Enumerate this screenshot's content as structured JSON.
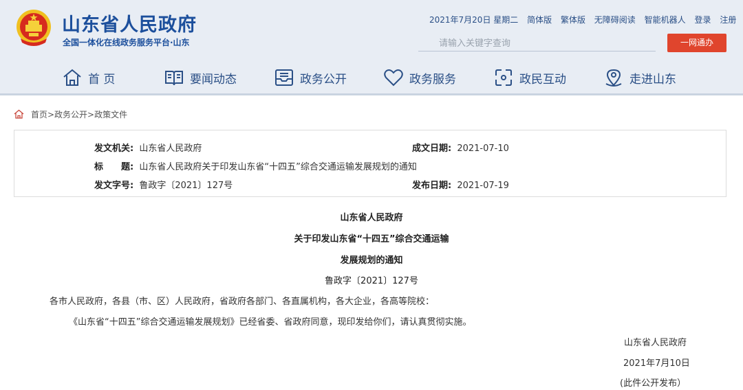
{
  "header": {
    "site_title": "山东省人民政府",
    "site_subtitle": "全国一体化在线政务服务平台·山东",
    "top_links": {
      "date": "2021年7月20日 星期二",
      "simplified": "简体版",
      "traditional": "繁体版",
      "accessible": "无障碍阅读",
      "robot": "智能机器人",
      "login": "登录",
      "register": "注册"
    },
    "search_placeholder": "请输入关键字查询",
    "onenet_button": "一网通办",
    "brand_color": "#1c4f9c",
    "accent_color": "#e0452d"
  },
  "nav": [
    {
      "label": "首 页",
      "icon": "home-icon"
    },
    {
      "label": "要闻动态",
      "icon": "book-icon"
    },
    {
      "label": "政务公开",
      "icon": "inbox-icon"
    },
    {
      "label": "政务服务",
      "icon": "heart-icon"
    },
    {
      "label": "政民互动",
      "icon": "interaction-icon"
    },
    {
      "label": "走进山东",
      "icon": "location-icon"
    }
  ],
  "breadcrumb": "首页>政务公开>政策文件",
  "meta": {
    "issuer_label": "发文机关:",
    "issuer": "山东省人民政府",
    "date_made_label": "成文日期:",
    "date_made": "2021-07-10",
    "title_label": "标　　题:",
    "title": "山东省人民政府关于印发山东省“十四五”综合交通运输发展规划的通知",
    "doc_no_label": "发文字号:",
    "doc_no": "鲁政字〔2021〕127号",
    "publish_label": "发布日期:",
    "publish_date": "2021-07-19"
  },
  "document": {
    "heading1": "山东省人民政府",
    "heading2": "关于印发山东省“十四五”综合交通运输",
    "heading3": "发展规划的通知",
    "doc_no": "鲁政字〔2021〕127号",
    "recipients": "各市人民政府，各县（市、区）人民政府，省政府各部门、各直属机构，各大企业，各高等院校：",
    "body": "《山东省“十四五”综合交通运输发展规划》已经省委、省政府同意，现印发给你们，请认真贯彻实施。",
    "signature": "山东省人民政府",
    "sign_date": "2021年7月10日",
    "note": "(此件公开发布）"
  }
}
